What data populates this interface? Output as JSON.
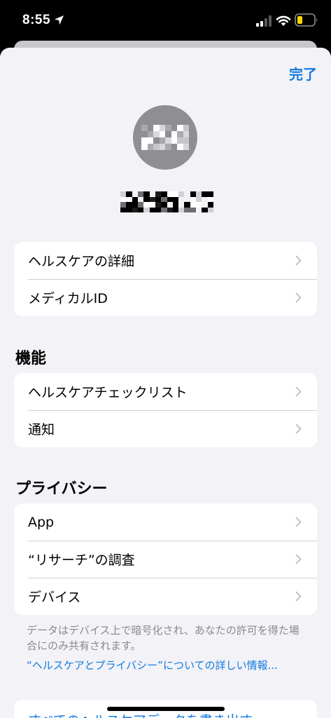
{
  "status_bar": {
    "time": "8:55",
    "icons": [
      "location-arrow-icon",
      "cellular-signal-icon",
      "wifi-icon",
      "battery-low-icon"
    ],
    "battery_color": "#ffd60a"
  },
  "sheet": {
    "done_label": "完了",
    "accent_color": "#147be0"
  },
  "profile": {
    "avatar_color": "#8e8e93",
    "name_obscured": true
  },
  "group1": {
    "items": [
      {
        "label": "ヘルスケアの詳細"
      },
      {
        "label": "メディカルID"
      }
    ]
  },
  "features": {
    "title": "機能",
    "items": [
      {
        "label": "ヘルスケアチェックリスト"
      },
      {
        "label": "通知"
      }
    ]
  },
  "privacy": {
    "title": "プライバシー",
    "items": [
      {
        "label": "App"
      },
      {
        "label": "“リサーチ”の調査"
      },
      {
        "label": "デバイス"
      }
    ],
    "footer_note": "データはデバイス上で暗号化され、あなたの許可を得た場合にのみ共有されます。",
    "footer_link": "“ヘルスケアとプライバシー”についての詳しい情報..."
  },
  "export": {
    "label": "すべてのヘルスケアデータを書き出す"
  }
}
